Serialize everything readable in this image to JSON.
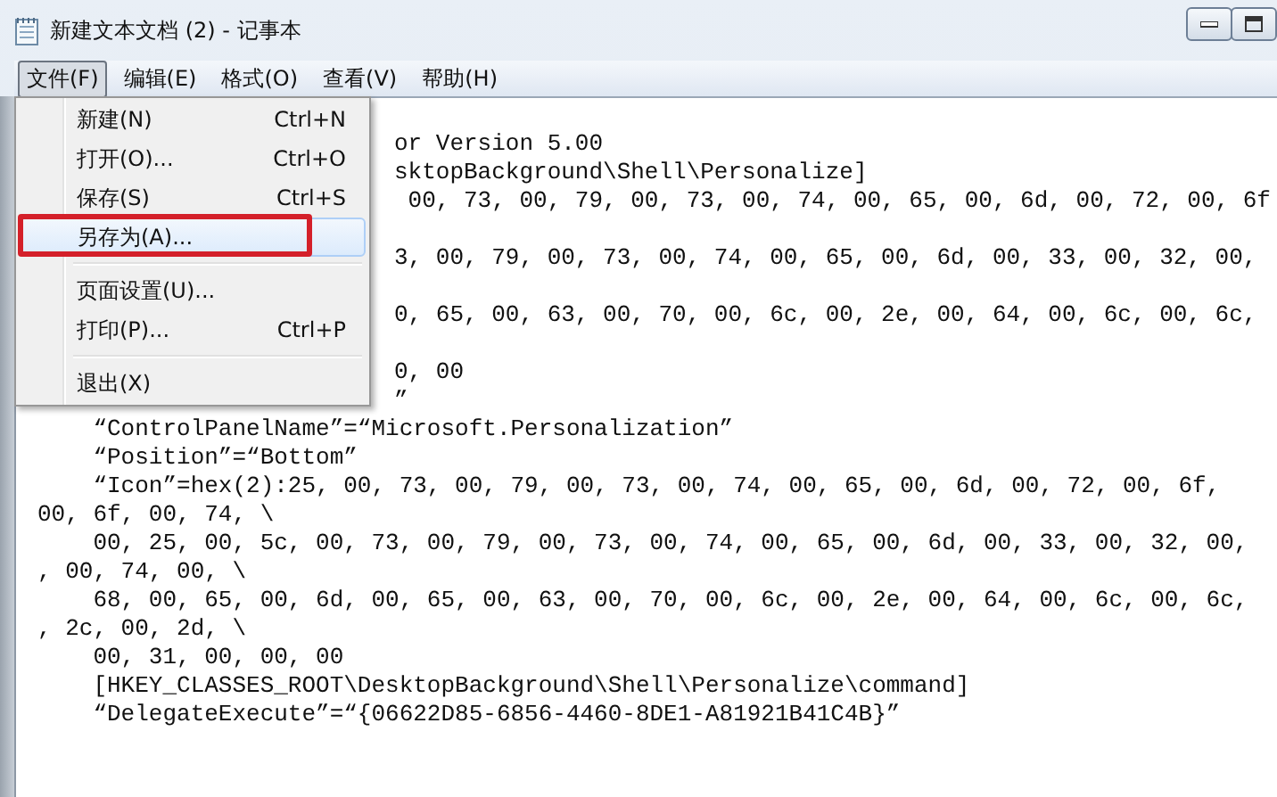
{
  "window": {
    "title": "新建文本文档 (2) - 记事本"
  },
  "menu_bar": [
    {
      "label": "文件(F)",
      "selected": true
    },
    {
      "label": "编辑(E)",
      "selected": false
    },
    {
      "label": "格式(O)",
      "selected": false
    },
    {
      "label": "查看(V)",
      "selected": false
    },
    {
      "label": "帮助(H)",
      "selected": false
    }
  ],
  "file_menu": [
    {
      "kind": "item",
      "label": "新建(N)",
      "shortcut": "Ctrl+N",
      "selected": false,
      "annotated": false
    },
    {
      "kind": "item",
      "label": "打开(O)...",
      "shortcut": "Ctrl+O",
      "selected": false,
      "annotated": false
    },
    {
      "kind": "item",
      "label": "保存(S)",
      "shortcut": "Ctrl+S",
      "selected": false,
      "annotated": false
    },
    {
      "kind": "item",
      "label": "另存为(A)...",
      "selected": true,
      "annotated": true
    },
    {
      "kind": "separator"
    },
    {
      "kind": "item",
      "label": "页面设置(U)...",
      "selected": false,
      "annotated": false
    },
    {
      "kind": "item",
      "label": "打印(P)...",
      "shortcut": "Ctrl+P",
      "selected": false,
      "annotated": false
    },
    {
      "kind": "separator"
    },
    {
      "kind": "item",
      "label": "退出(X)",
      "selected": false,
      "annotated": false
    }
  ],
  "editor_lines": [
    {
      "kind": "behind_menu",
      "text": "or Version 5.00"
    },
    {
      "kind": "behind_menu",
      "text": "sktopBackground\\Shell\\Personalize]"
    },
    {
      "kind": "behind_menu",
      "text": " 00, 73, 00, 79, 00, 73, 00, 74, 00, 65, 00, 6d, 00, 72, 00, 6f"
    },
    {
      "kind": "blank"
    },
    {
      "kind": "behind_menu",
      "text": "3, 00, 79, 00, 73, 00, 74, 00, 65, 00, 6d, 00, 33, 00, 32, 00,"
    },
    {
      "kind": "blank"
    },
    {
      "kind": "behind_menu",
      "text": "0, 65, 00, 63, 00, 70, 00, 6c, 00, 2e, 00, 64, 00, 6c, 00, 6c,"
    },
    {
      "kind": "blank"
    },
    {
      "kind": "behind_menu",
      "text": "0, 00"
    },
    {
      "kind": "behind_menu",
      "text": "”"
    },
    {
      "kind": "full",
      "text": "    “ControlPanelName”=“Microsoft.Personalization”"
    },
    {
      "kind": "full",
      "text": "    “Position”=“Bottom”"
    },
    {
      "kind": "full",
      "text": "    “Icon”=hex(2):25, 00, 73, 00, 79, 00, 73, 00, 74, 00, 65, 00, 6d, 00, 72, 00, 6f,"
    },
    {
      "kind": "full",
      "text": "00, 6f, 00, 74, \\"
    },
    {
      "kind": "full",
      "text": "    00, 25, 00, 5c, 00, 73, 00, 79, 00, 73, 00, 74, 00, 65, 00, 6d, 00, 33, 00, 32, 00,"
    },
    {
      "kind": "full",
      "text": ", 00, 74, 00, \\"
    },
    {
      "kind": "full",
      "text": "    68, 00, 65, 00, 6d, 00, 65, 00, 63, 00, 70, 00, 6c, 00, 2e, 00, 64, 00, 6c, 00, 6c,"
    },
    {
      "kind": "full",
      "text": ", 2c, 00, 2d, \\"
    },
    {
      "kind": "full",
      "text": "    00, 31, 00, 00, 00"
    },
    {
      "kind": "full",
      "text": "    [HKEY_CLASSES_ROOT\\DesktopBackground\\Shell\\Personalize\\command]"
    },
    {
      "kind": "full",
      "text": "    “DelegateExecute”=“{06622D85-6856-4460-8DE1-A81921B41C4B}”"
    }
  ]
}
